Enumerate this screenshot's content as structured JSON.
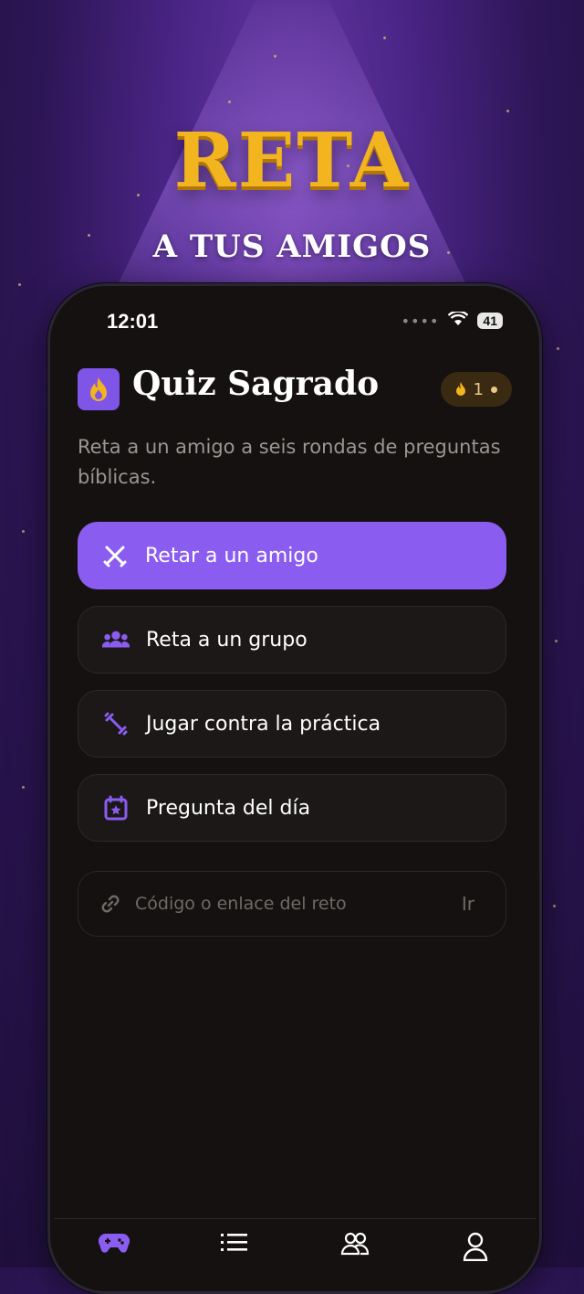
{
  "promo": {
    "title": "RETA",
    "subtitle": "A TUS AMIGOS"
  },
  "status_bar": {
    "time": "12:01",
    "battery": "41"
  },
  "header": {
    "app_name": "Quiz Sagrado",
    "streak_count": "1"
  },
  "subtitle": "Reta a un amigo a seis rondas de preguntas bíblicas.",
  "actions": [
    {
      "label": "Retar a un amigo",
      "icon": "swords-icon",
      "primary": true
    },
    {
      "label": "Reta a un grupo",
      "icon": "group-icon",
      "primary": false
    },
    {
      "label": "Jugar contra la práctica",
      "icon": "dumbbell-icon",
      "primary": false
    },
    {
      "label": "Pregunta del día",
      "icon": "calendar-star-icon",
      "primary": false
    }
  ],
  "code_input": {
    "placeholder": "Código o enlace del reto",
    "value": "",
    "go_label": "Ir"
  },
  "tabbar": [
    {
      "icon": "gamepad-icon",
      "active": true
    },
    {
      "icon": "list-icon",
      "active": false
    },
    {
      "icon": "friends-icon",
      "active": false
    },
    {
      "icon": "profile-icon",
      "active": false
    }
  ],
  "colors": {
    "accent": "#8b5cf0",
    "gold": "#f2b51f",
    "background": "#141110"
  }
}
